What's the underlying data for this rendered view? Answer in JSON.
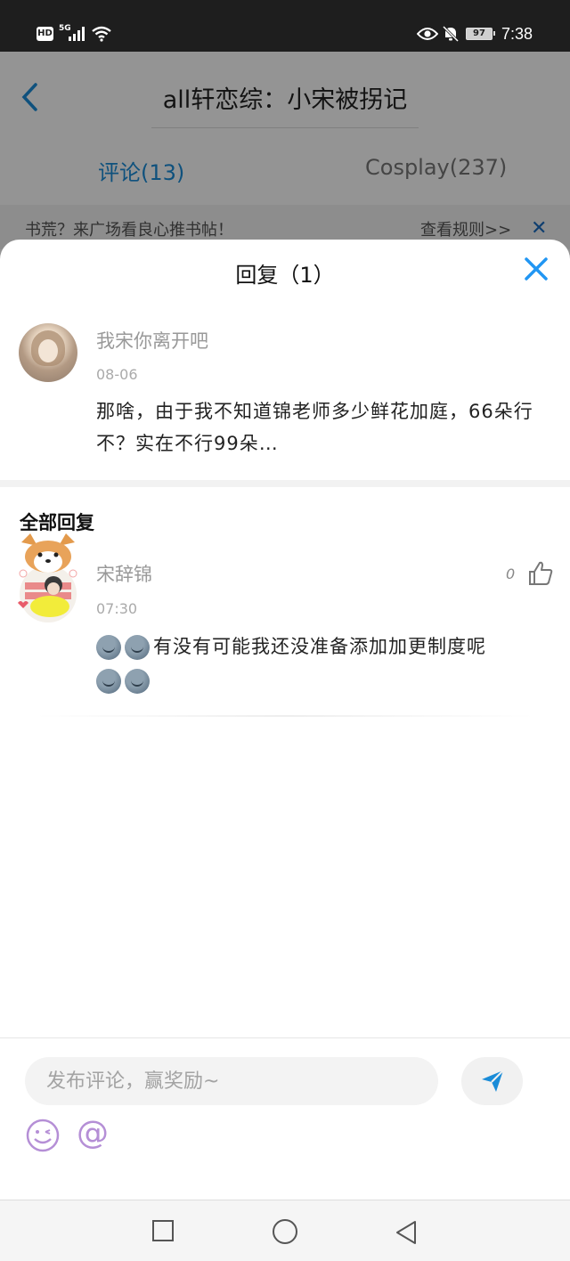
{
  "status_bar": {
    "hd": "HD",
    "network": "5G",
    "battery": "97",
    "time": "7:38"
  },
  "background_page": {
    "title": "all轩恋综：小宋被拐记",
    "tabs": [
      {
        "label": "评论(13)",
        "active": true
      },
      {
        "label": "Cosplay(237)",
        "active": false
      }
    ],
    "notice": "书荒？来广场看良心推书帖！",
    "rules_link": "查看规则>>"
  },
  "sheet": {
    "title": "回复（1）",
    "post": {
      "user": "我宋你离开吧",
      "date": "08-06",
      "text": "那啥，由于我不知道锦老师多少鲜花加庭，66朵行不？实在不行99朵…"
    },
    "section_title": "全部回复",
    "replies": [
      {
        "user": "宋辞锦",
        "date": "07:30",
        "likes": "0",
        "text": "有没有可能我还没准备添加加更制度呢"
      }
    ]
  },
  "composer": {
    "placeholder": "发布评论，赢奖励~",
    "at_symbol": "@"
  },
  "colors": {
    "accent": "#1a8cd8",
    "close_blue": "#2196f3",
    "emoji_purple": "#b58fd6"
  }
}
